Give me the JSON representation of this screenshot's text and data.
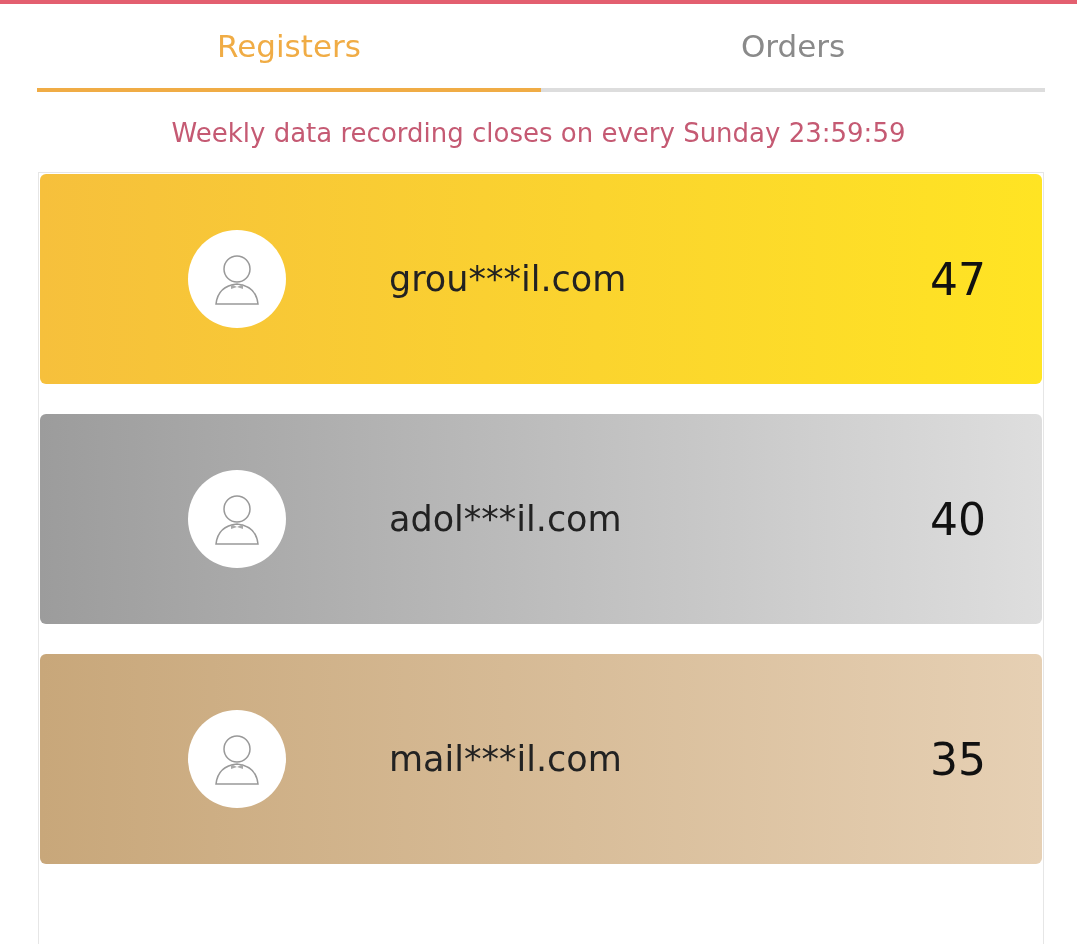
{
  "tabs": [
    {
      "label": "Registers",
      "selected": true
    },
    {
      "label": "Orders",
      "selected": false
    }
  ],
  "notice": "Weekly data recording closes on every Sunday 23:59:59",
  "ranking": [
    {
      "kind": "gold",
      "name": "grou***il.com",
      "score": "47"
    },
    {
      "kind": "silver",
      "name": "adol***il.com",
      "score": "40"
    },
    {
      "kind": "bronze",
      "name": "mail***il.com",
      "score": "35"
    }
  ]
}
